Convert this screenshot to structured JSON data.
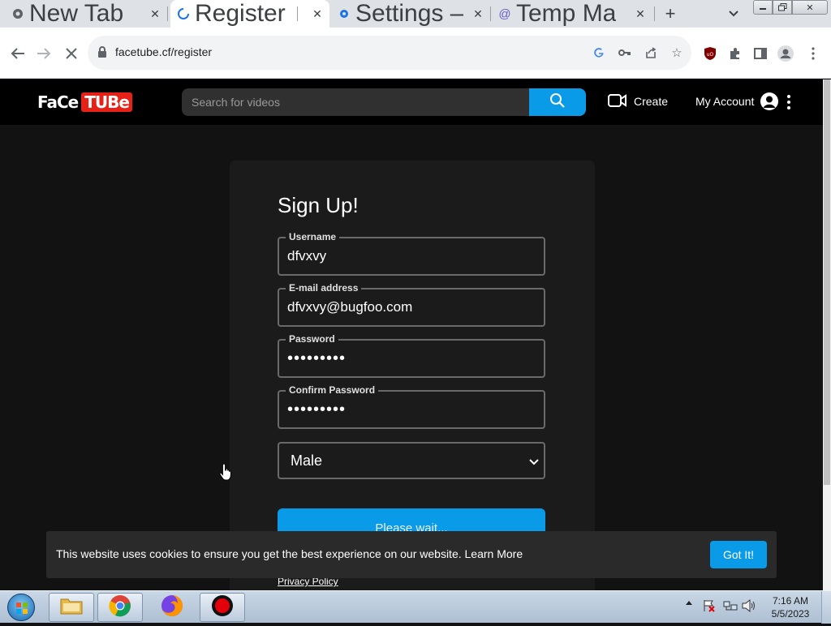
{
  "browser": {
    "tabs": [
      {
        "title": "New Tab",
        "icon": "chrome-icon",
        "active": false
      },
      {
        "title": "Register",
        "icon": "loading-spinner-icon",
        "active": true
      },
      {
        "title": "Settings –",
        "icon": "gear-icon",
        "active": false
      },
      {
        "title": "Temp Ma",
        "icon": "at-sign-icon",
        "active": false
      }
    ],
    "url": "facetube.cf/register"
  },
  "site": {
    "logo_face": "FaCe",
    "logo_tube": "TUBe",
    "search_placeholder": "Search for videos",
    "create_label": "Create",
    "account_label": "My Account"
  },
  "form": {
    "heading": "Sign Up!",
    "fields": [
      {
        "label": "Username",
        "value": "dfvxvy",
        "type": "text"
      },
      {
        "label": "E-mail address",
        "value": "dfvxvy@bugfoo.com",
        "type": "text"
      },
      {
        "label": "Password",
        "value": "•••••••••",
        "type": "password"
      },
      {
        "label": "Confirm Password",
        "value": "•••••••••",
        "type": "password"
      }
    ],
    "gender_selected": "Male",
    "submit_label": "Please wait...",
    "privacy_link": "Privacy Policy"
  },
  "cookie_bar": {
    "message": "This website uses cookies to ensure you get the best experience on our website. Learn More",
    "button": "Got It!"
  },
  "taskbar": {
    "time": "7:16 AM",
    "date": "5/5/2023"
  },
  "colors": {
    "accent": "#0a9be8",
    "logo_red": "#e62117",
    "page_bg": "#121212",
    "card_bg": "#1b1b1b"
  }
}
